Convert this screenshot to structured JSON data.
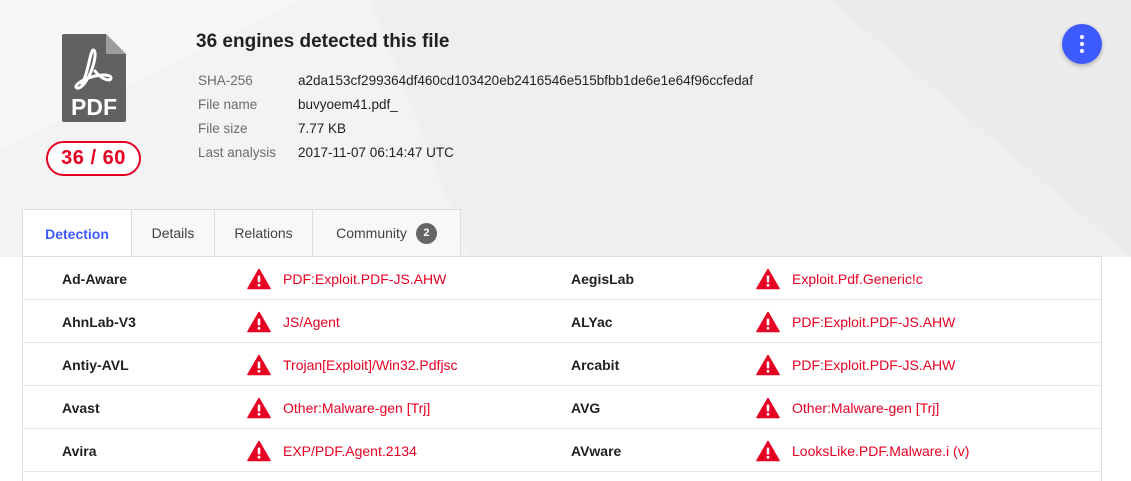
{
  "summary": {
    "file_icon": "pdf-file-icon",
    "file_icon_label": "PDF",
    "score": "36 / 60",
    "title": "36 engines detected this file",
    "meta": [
      {
        "label": "SHA-256",
        "value": "a2da153cf299364df460cd103420eb2416546e515bfbb1de6e1e64f96ccfedaf"
      },
      {
        "label": "File name",
        "value": "buvyoem41.pdf_"
      },
      {
        "label": "File size",
        "value": "7.77 KB"
      },
      {
        "label": "Last analysis",
        "value": "2017-11-07 06:14:47 UTC"
      }
    ]
  },
  "actions": {
    "menu_icon": "more-vert-icon"
  },
  "tabs": [
    {
      "label": "Detection",
      "active": true
    },
    {
      "label": "Details"
    },
    {
      "label": "Relations"
    },
    {
      "label": "Community",
      "badge": "2"
    }
  ],
  "detections": [
    {
      "left": {
        "engine": "Ad-Aware",
        "result": "PDF:Exploit.PDF-JS.AHW"
      },
      "right": {
        "engine": "AegisLab",
        "result": "Exploit.Pdf.Generic!c"
      }
    },
    {
      "left": {
        "engine": "AhnLab-V3",
        "result": "JS/Agent"
      },
      "right": {
        "engine": "ALYac",
        "result": "PDF:Exploit.PDF-JS.AHW"
      }
    },
    {
      "left": {
        "engine": "Antiy-AVL",
        "result": "Trojan[Exploit]/Win32.Pdfjsc"
      },
      "right": {
        "engine": "Arcabit",
        "result": "PDF:Exploit.PDF-JS.AHW"
      }
    },
    {
      "left": {
        "engine": "Avast",
        "result": "Other:Malware-gen [Trj]"
      },
      "right": {
        "engine": "AVG",
        "result": "Other:Malware-gen [Trj]"
      }
    },
    {
      "left": {
        "engine": "Avira",
        "result": "EXP/PDF.Agent.2134"
      },
      "right": {
        "engine": "AVware",
        "result": "LooksLike.PDF.Malware.i (v)"
      }
    }
  ],
  "icons": {
    "detection_icon": "warning-icon"
  },
  "colors": {
    "accent": "#3d5afe",
    "malicious": "#e60022",
    "header_bg": "#f3f3f3"
  }
}
